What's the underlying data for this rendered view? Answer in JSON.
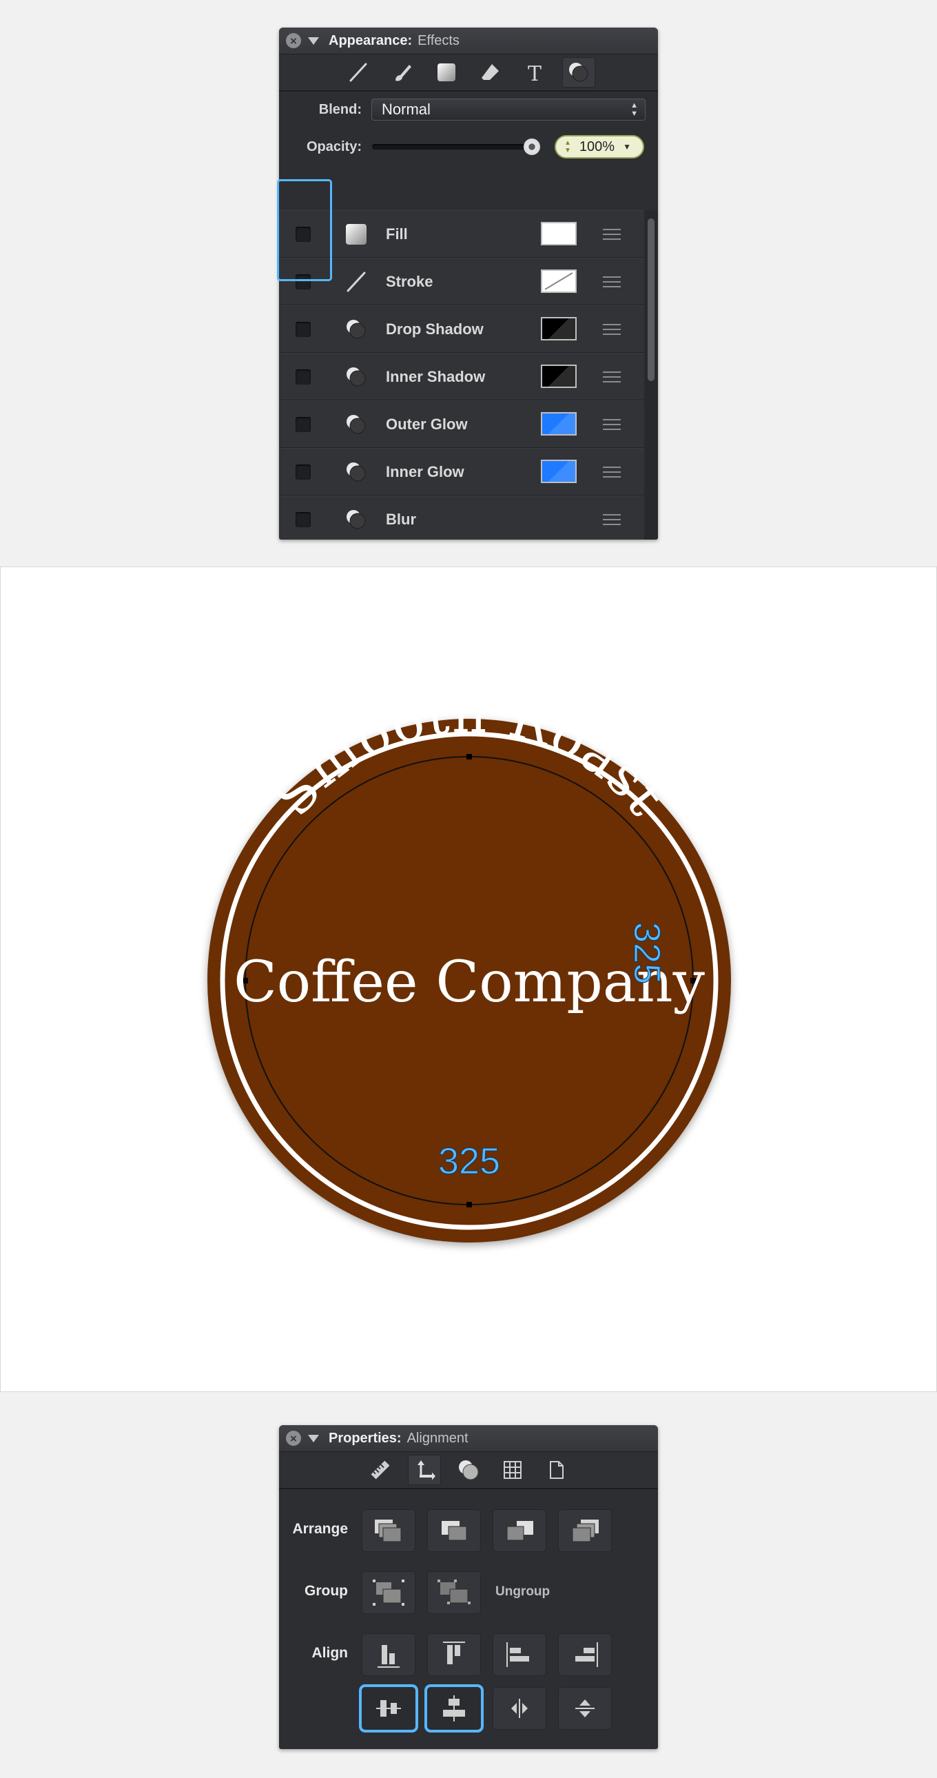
{
  "appearance": {
    "title": "Appearance:",
    "subtitle": "Effects",
    "tools": [
      "line-tool-icon",
      "brush-tool-icon",
      "fill-tool-icon",
      "eraser-tool-icon",
      "text-tool-icon",
      "effects-tool-icon"
    ],
    "blend_label": "Blend:",
    "blend_value": "Normal",
    "opacity_label": "Opacity:",
    "opacity_value": "100%",
    "opacity_level": 1.0,
    "effects": [
      {
        "name": "Fill",
        "swatch_color": "#ffffff",
        "icon": "gradient-square-icon"
      },
      {
        "name": "Stroke",
        "swatch_color": "none",
        "icon": "stroke-line-icon"
      },
      {
        "name": "Drop Shadow",
        "swatch_color": "#000000",
        "icon": "shadow-circles-icon"
      },
      {
        "name": "Inner Shadow",
        "swatch_color": "#000000",
        "icon": "shadow-circles-icon"
      },
      {
        "name": "Outer Glow",
        "swatch_color": "#1e7bff",
        "icon": "shadow-circles-icon"
      },
      {
        "name": "Inner Glow",
        "swatch_color": "#1e7bff",
        "icon": "shadow-circles-icon"
      },
      {
        "name": "Blur",
        "swatch_color": "",
        "icon": "shadow-circles-icon"
      }
    ],
    "add_label": "+"
  },
  "canvas": {
    "badge_color": "#6b2f03",
    "top_text": "Smooth Roast",
    "center_text": "Coffee Company",
    "dimension_bottom": "325",
    "dimension_right": "325",
    "dimension_color": "#56b7ff"
  },
  "properties": {
    "title": "Properties:",
    "subtitle": "Alignment",
    "tools": [
      "ruler-icon",
      "move-arrows-icon",
      "shapes-icon",
      "grid-icon",
      "page-icon"
    ],
    "arrange_label": "Arrange",
    "group_label": "Group",
    "ungroup_label": "Ungroup",
    "align_label": "Align"
  }
}
